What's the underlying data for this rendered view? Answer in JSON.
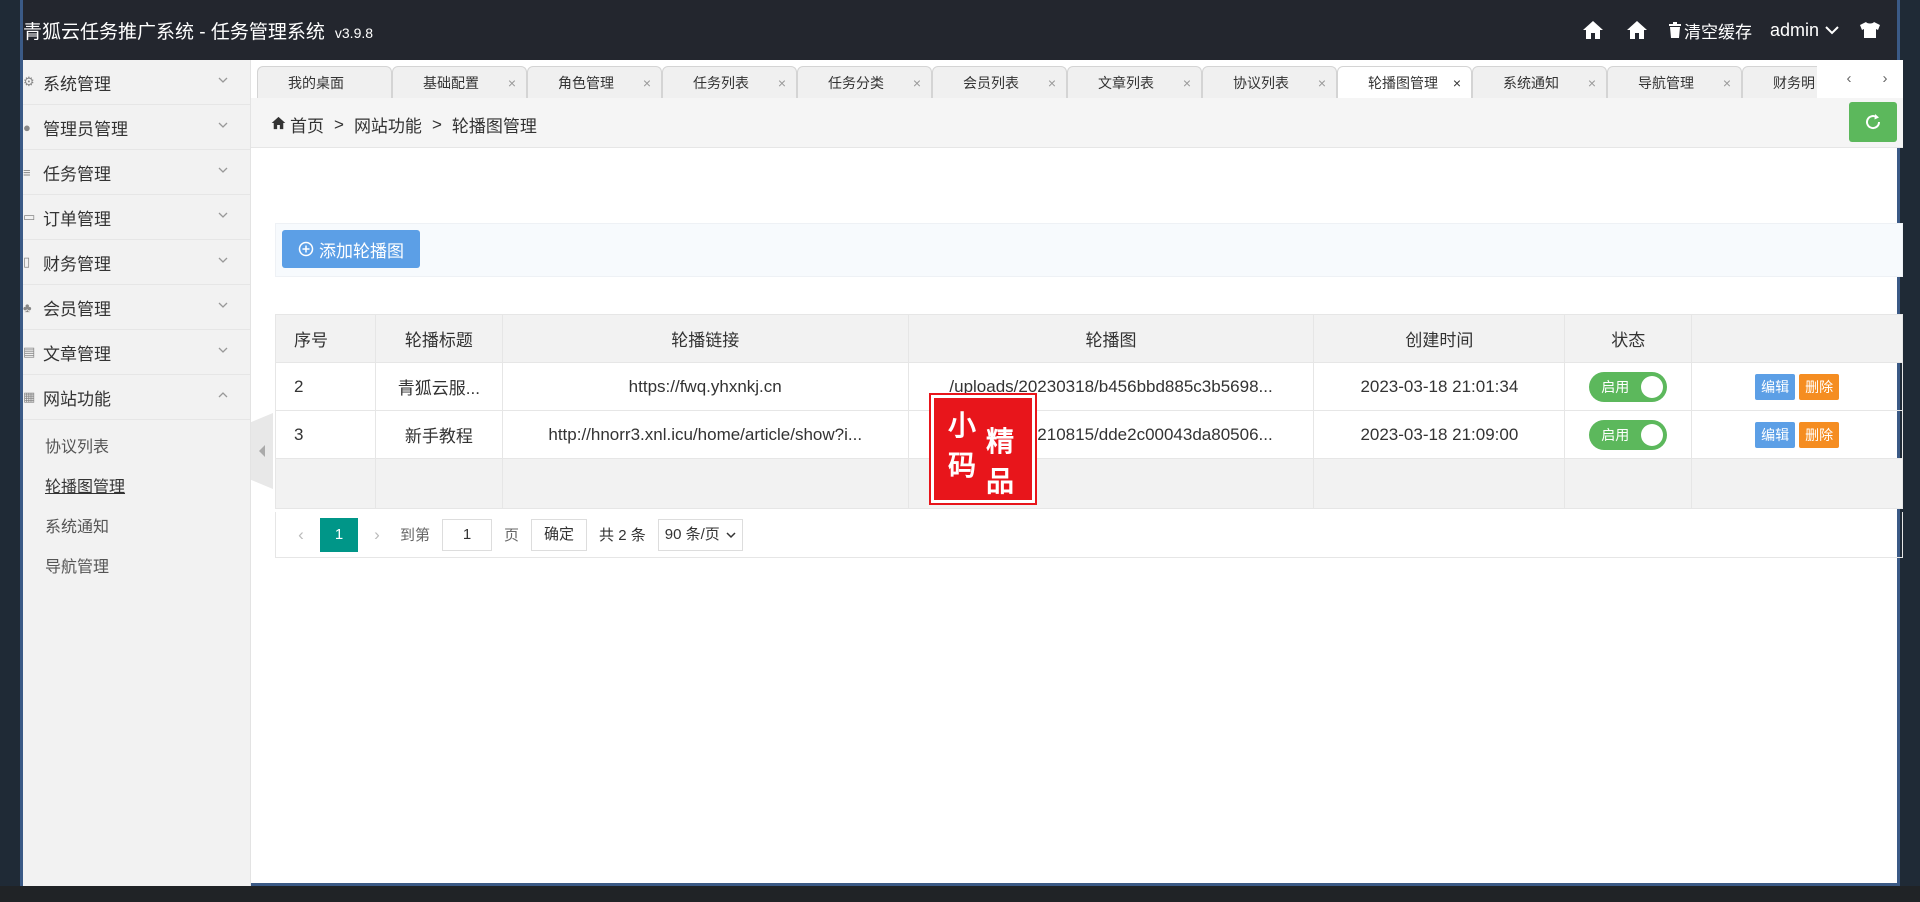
{
  "header": {
    "title": "青狐云任务推广系统 - 任务管理系统",
    "version": "v3.9.8",
    "clear_cache": "清空缓存",
    "user": "admin"
  },
  "sidebar": {
    "items": [
      {
        "label": "系统管理"
      },
      {
        "label": "管理员管理"
      },
      {
        "label": "任务管理"
      },
      {
        "label": "订单管理"
      },
      {
        "label": "财务管理"
      },
      {
        "label": "会员管理"
      },
      {
        "label": "文章管理"
      },
      {
        "label": "网站功能"
      }
    ],
    "submenu": [
      {
        "label": "协议列表"
      },
      {
        "label": "轮播图管理"
      },
      {
        "label": "系统通知"
      },
      {
        "label": "导航管理"
      }
    ]
  },
  "tabs": [
    {
      "label": "我的桌面"
    },
    {
      "label": "基础配置"
    },
    {
      "label": "角色管理"
    },
    {
      "label": "任务列表"
    },
    {
      "label": "任务分类"
    },
    {
      "label": "会员列表"
    },
    {
      "label": "文章列表"
    },
    {
      "label": "协议列表"
    },
    {
      "label": "轮播图管理"
    },
    {
      "label": "系统通知"
    },
    {
      "label": "导航管理"
    },
    {
      "label": "财务明"
    }
  ],
  "breadcrumb": {
    "home": "首页",
    "sep": ">",
    "level1": "网站功能",
    "level2": "轮播图管理"
  },
  "toolbar": {
    "add_label": "添加轮播图"
  },
  "table": {
    "headers": [
      "序号",
      "轮播标题",
      "轮播链接",
      "轮播图",
      "创建时间",
      "状态",
      ""
    ],
    "rows": [
      {
        "id": "2",
        "title": "青狐云服...",
        "link": "https://fwq.yhxnkj.cn",
        "image": "/uploads/20230318/b456bbd885c3b5698...",
        "created": "2023-03-18 21:01:34",
        "status": "启用"
      },
      {
        "id": "3",
        "title": "新手教程",
        "link": "http://hnorr3.xnl.icu/home/article/show?i...",
        "image": "/uploads/20210815/dde2c00043da80506...",
        "created": "2023-03-18 21:09:00",
        "status": "启用"
      }
    ],
    "edit_label": "编辑",
    "delete_label": "删除"
  },
  "pager": {
    "current": "1",
    "goto_label": "到第",
    "goto_value": "1",
    "page_unit": "页",
    "confirm": "确定",
    "total": "共 2 条",
    "page_size": "90 条/页"
  },
  "stamp": {
    "chars": [
      "小",
      "精",
      "码",
      "品"
    ]
  },
  "colors": {
    "header_bg": "#23262e",
    "accent_green": "#5cb85c",
    "accent_blue": "#5c9fe6",
    "delete_orange": "#f58d21",
    "pager_teal": "#009688",
    "stamp_red": "#e8151b"
  }
}
